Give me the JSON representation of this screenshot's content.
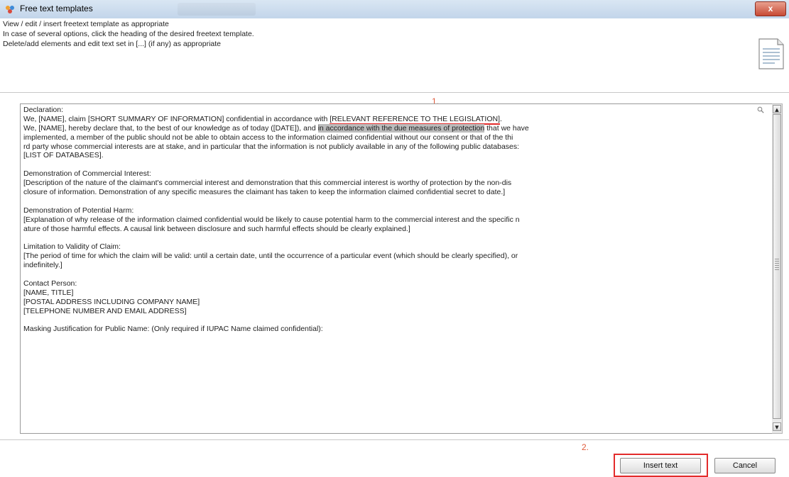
{
  "window": {
    "title": "Free text templates",
    "close_label": "x"
  },
  "instructions": [
    "View / edit / insert freetext template as appropriate",
    "In case of several options, click the heading of the desired freetext template.",
    "Delete/add elements and edit text set in [...] (if any) as appropriate"
  ],
  "markers": {
    "one": "1.",
    "two": "2."
  },
  "template_text": {
    "declaration_heading": "Declaration:",
    "decl_line1_before": "We, [NAME], claim [SHORT SUMMARY OF INFORMATION] confidential in accordance with ",
    "decl_line1_ref": "[RELEVANT REFERENCE TO THE LEGISLATION]",
    "decl_line1_after": ".",
    "decl_line2_before": "We, [NAME], hereby declare that, to the best of our knowledge as of today ([DATE]), and ",
    "decl_line2_hl": "in accordance with the due measures of protection",
    "decl_line2_after": " that we have",
    "decl_line3": " implemented, a member of the public should not be able to obtain access to the information claimed confidential without our consent or that of the thi",
    "decl_line4": "rd party whose commercial interests are at stake, and in particular that the information is not publicly available in any of the following public databases:",
    "decl_line5": " [LIST OF DATABASES].",
    "commercial_heading": "Demonstration of Commercial Interest:",
    "commercial_line1": "[Description of the nature of the claimant's commercial interest and demonstration that this commercial interest is worthy of protection by the non-dis",
    "commercial_line2": "closure of information. Demonstration of any specific measures the claimant has taken to keep the information claimed confidential secret to date.]",
    "harm_heading": "Demonstration of Potential Harm:",
    "harm_line1": "[Explanation of why release of the information claimed confidential would be likely to cause potential harm to the commercial interest and the specific n",
    "harm_line2": "ature of those harmful effects. A causal link between disclosure and such harmful effects should be clearly explained.]",
    "limitation_heading": "Limitation to Validity of Claim:",
    "limitation_line1": "[The period of time for which the claim will be valid: until a certain date, until the occurrence of a particular event (which should be clearly specified), or",
    "limitation_line2": "indefinitely.]",
    "contact_heading": "Contact Person:",
    "contact_line1": "[NAME, TITLE]",
    "contact_line2": "[POSTAL ADDRESS INCLUDING COMPANY NAME]",
    "contact_line3": "[TELEPHONE NUMBER AND EMAIL ADDRESS]",
    "masking_line": "Masking Justification for Public Name: (Only required if IUPAC Name claimed confidential):"
  },
  "buttons": {
    "insert_text": "Insert text",
    "cancel": "Cancel"
  },
  "icons": {
    "app": "app-icon",
    "document": "document-icon",
    "magnify": "magnifier-icon",
    "scroll_up": "scroll-up-arrow-icon",
    "scroll_down": "scroll-down-arrow-icon"
  },
  "colors": {
    "annotation_red": "#e32b2b",
    "marker_orange": "#e05a3a"
  }
}
